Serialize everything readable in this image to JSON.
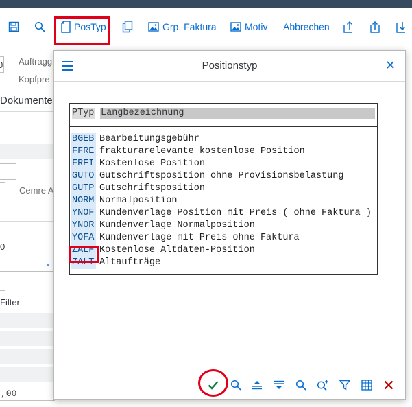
{
  "toolbar": {
    "postyp_label": "PosTyp",
    "grp_faktura_label": "Grp. Faktura",
    "motiv_label": "Motiv",
    "abbrechen_label": "Abbrechen"
  },
  "background": {
    "field_value_1": "0",
    "auftrag_label": "Auftragg",
    "kopfpre_label": "Kopfpre",
    "dokumente_label": "Dokumente",
    "cemre_label": "Cemre A",
    "field_value_2": "0",
    "filter_label": "Filter",
    "amount_value": ",00"
  },
  "dialog": {
    "title": "Positionstyp",
    "col_code": "PTyp",
    "col_desc": "Langbezeichnung",
    "rows": [
      {
        "code": "BGEB",
        "desc": "Bearbeitungsgebühr"
      },
      {
        "code": "FFRE",
        "desc": "frakturarelevante kostenlose Position"
      },
      {
        "code": "FREI",
        "desc": "Kostenlose Position"
      },
      {
        "code": "GUTO",
        "desc": "Gutschriftsposition ohne Provisionsbelastung"
      },
      {
        "code": "GUTP",
        "desc": "Gutschriftsposition"
      },
      {
        "code": "NORM",
        "desc": "Normalposition"
      },
      {
        "code": "YNOF",
        "desc": "Kundenverlage Position mit Preis ( ohne Faktura )"
      },
      {
        "code": "YNOR",
        "desc": "Kundenverlage Normalposition"
      },
      {
        "code": "YOFA",
        "desc": "Kundenverlage mit Preis ohne Faktura"
      },
      {
        "code": "ZALF",
        "desc": "Kostenlose Altdaten-Position"
      },
      {
        "code": "ZALT",
        "desc": "Altaufträge"
      }
    ]
  },
  "colors": {
    "accent": "#0a6ed1",
    "highlight": "#e0001a",
    "confirm": "#107e3e",
    "cancel": "#bb0000"
  }
}
